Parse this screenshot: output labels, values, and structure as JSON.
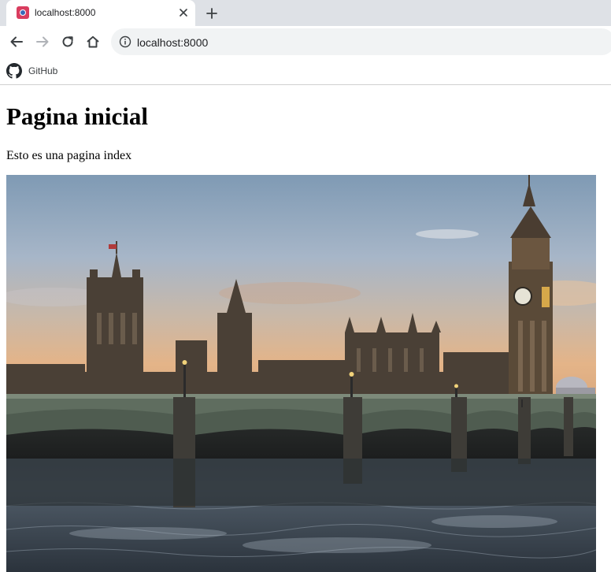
{
  "browser": {
    "tab": {
      "title": "localhost:8000",
      "favicon": "localhost-favicon"
    },
    "address_bar": {
      "url": "localhost:8000"
    },
    "bookmarks": [
      {
        "label": "GitHub",
        "icon": "github-icon"
      }
    ]
  },
  "page": {
    "heading": "Pagina inicial",
    "paragraph": "Esto es una pagina index",
    "image": {
      "subject": "photo",
      "alt": ""
    }
  }
}
